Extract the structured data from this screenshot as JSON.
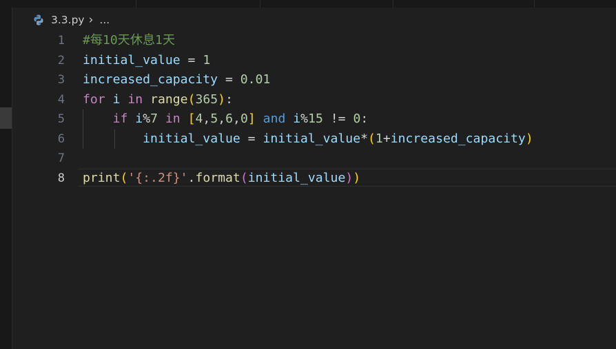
{
  "breadcrumb": {
    "icon": "python-file-icon",
    "file": "3.3.py",
    "separator": "›",
    "more": "..."
  },
  "gutter": {
    "line_numbers": [
      "1",
      "2",
      "3",
      "4",
      "5",
      "6",
      "7",
      "8"
    ],
    "active_line": "8"
  },
  "code_lines": [
    [
      {
        "t": "#每10天休息1天",
        "c": "c-comment"
      }
    ],
    [
      {
        "t": "initial_value",
        "c": "c-var"
      },
      {
        "t": " = ",
        "c": "c-op"
      },
      {
        "t": "1",
        "c": "c-num"
      }
    ],
    [
      {
        "t": "increased_capacity",
        "c": "c-var"
      },
      {
        "t": " = ",
        "c": "c-op"
      },
      {
        "t": "0.01",
        "c": "c-num"
      }
    ],
    [
      {
        "t": "for",
        "c": "c-kw"
      },
      {
        "t": " ",
        "c": "c-op"
      },
      {
        "t": "i",
        "c": "c-var"
      },
      {
        "t": " ",
        "c": "c-op"
      },
      {
        "t": "in",
        "c": "c-kw"
      },
      {
        "t": " ",
        "c": "c-op"
      },
      {
        "t": "range",
        "c": "c-fn"
      },
      {
        "t": "(",
        "c": "c-b1"
      },
      {
        "t": "365",
        "c": "c-num"
      },
      {
        "t": ")",
        "c": "c-b1"
      },
      {
        "t": ":",
        "c": "c-op"
      }
    ],
    [
      {
        "t": "    ",
        "c": "c-op"
      },
      {
        "t": "if",
        "c": "c-kw"
      },
      {
        "t": " ",
        "c": "c-op"
      },
      {
        "t": "i",
        "c": "c-var"
      },
      {
        "t": "%",
        "c": "c-op"
      },
      {
        "t": "7",
        "c": "c-num"
      },
      {
        "t": " ",
        "c": "c-op"
      },
      {
        "t": "in",
        "c": "c-kw"
      },
      {
        "t": " ",
        "c": "c-op"
      },
      {
        "t": "[",
        "c": "c-b1"
      },
      {
        "t": "4",
        "c": "c-num"
      },
      {
        "t": ",",
        "c": "c-op"
      },
      {
        "t": "5",
        "c": "c-num"
      },
      {
        "t": ",",
        "c": "c-op"
      },
      {
        "t": "6",
        "c": "c-num"
      },
      {
        "t": ",",
        "c": "c-op"
      },
      {
        "t": "0",
        "c": "c-num"
      },
      {
        "t": "]",
        "c": "c-b1"
      },
      {
        "t": " ",
        "c": "c-op"
      },
      {
        "t": "and",
        "c": "c-op-kw"
      },
      {
        "t": " ",
        "c": "c-op"
      },
      {
        "t": "i",
        "c": "c-var"
      },
      {
        "t": "%",
        "c": "c-op"
      },
      {
        "t": "15",
        "c": "c-num"
      },
      {
        "t": " != ",
        "c": "c-op"
      },
      {
        "t": "0",
        "c": "c-num"
      },
      {
        "t": ":",
        "c": "c-op"
      }
    ],
    [
      {
        "t": "        ",
        "c": "c-op"
      },
      {
        "t": "initial_value",
        "c": "c-var"
      },
      {
        "t": " = ",
        "c": "c-op"
      },
      {
        "t": "initial_value",
        "c": "c-var"
      },
      {
        "t": "*",
        "c": "c-op"
      },
      {
        "t": "(",
        "c": "c-b1"
      },
      {
        "t": "1",
        "c": "c-num"
      },
      {
        "t": "+",
        "c": "c-op"
      },
      {
        "t": "increased_capacity",
        "c": "c-var"
      },
      {
        "t": ")",
        "c": "c-b1"
      }
    ],
    [],
    [
      {
        "t": "print",
        "c": "c-fn"
      },
      {
        "t": "(",
        "c": "c-b1"
      },
      {
        "t": "'{:.2f}'",
        "c": "c-str"
      },
      {
        "t": ".",
        "c": "c-op"
      },
      {
        "t": "format",
        "c": "c-fn"
      },
      {
        "t": "(",
        "c": "c-b2"
      },
      {
        "t": "initial_value",
        "c": "c-var"
      },
      {
        "t": ")",
        "c": "c-b2"
      },
      {
        "t": ")",
        "c": "c-b1"
      }
    ]
  ]
}
